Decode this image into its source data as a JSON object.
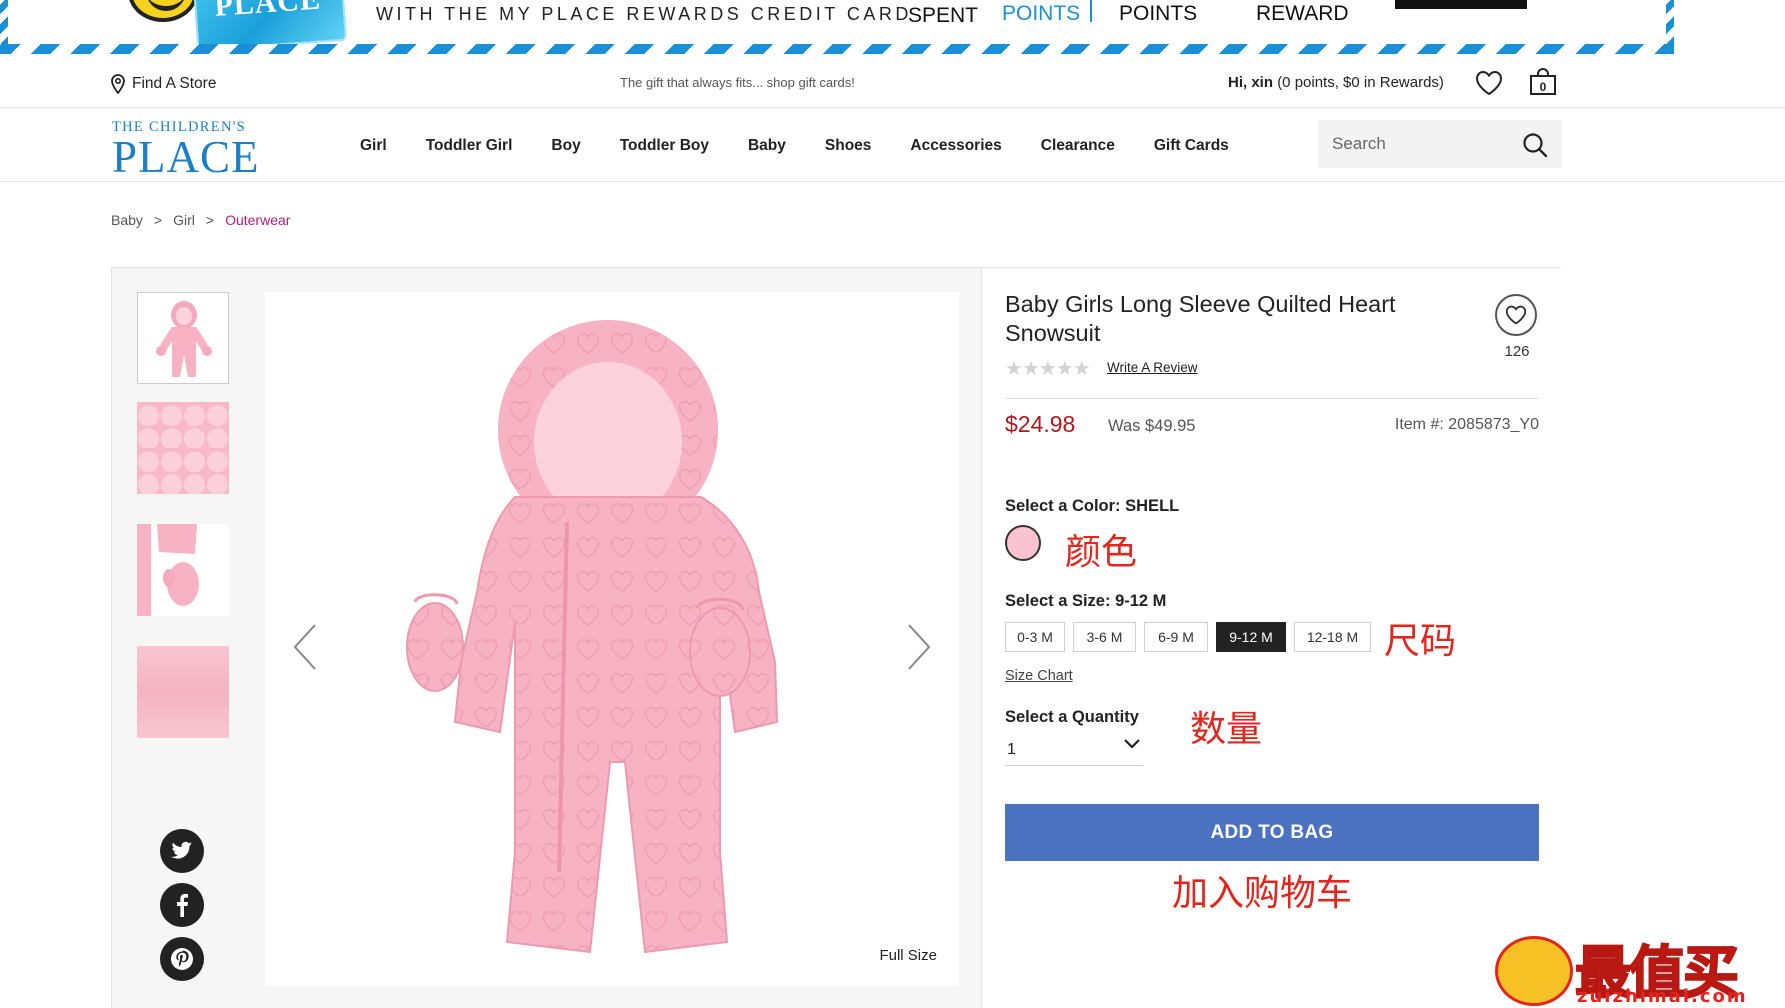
{
  "promo": {
    "card_text": "PLACE",
    "tagline": "WITH THE MY PLACE REWARDS CREDIT CARD",
    "spent": "SPENT",
    "points_blue": "POINTS",
    "points": "POINTS",
    "reward": "REWARD"
  },
  "util": {
    "find_store": "Find A Store",
    "message": "The gift that always fits... shop gift cards!",
    "greeting_name": "Hi, xin",
    "greeting_detail": "(0 points, $0 in Rewards)",
    "bag_count": "0"
  },
  "logo": {
    "line1": "THE CHILDREN'S",
    "line2": "PLACE"
  },
  "nav": [
    "Girl",
    "Toddler Girl",
    "Boy",
    "Toddler Boy",
    "Baby",
    "Shoes",
    "Accessories",
    "Clearance",
    "Gift Cards"
  ],
  "search": {
    "placeholder": "Search"
  },
  "breadcrumb": {
    "items": [
      "Baby",
      "Girl"
    ],
    "current": "Outerwear",
    "separator": ">"
  },
  "product": {
    "title": "Baby Girls Long Sleeve Quilted Heart Snowsuit",
    "favorites": "126",
    "rating": 0,
    "write_review": "Write A Review",
    "price": "$24.98",
    "was": "Was $49.95",
    "item_no": "Item #: 2085873_Y0",
    "color_label": "Select a Color:",
    "color_value": "SHELL",
    "color_swatch": "#f9c3cf",
    "size_label": "Select a Size:",
    "size_value": "9-12 M",
    "sizes": [
      "0-3 M",
      "3-6 M",
      "6-9 M",
      "9-12 M",
      "12-18 M"
    ],
    "selected_size_index": 3,
    "size_chart": "Size Chart",
    "qty_label": "Select a Quantity",
    "qty_value": "1",
    "add_to_bag": "ADD TO BAG",
    "full_size": "Full Size"
  },
  "annotations": {
    "color": "颜色",
    "size": "尺码",
    "quantity": "数量",
    "add_to_cart": "加入购物车"
  },
  "watermark": {
    "title": "最值买",
    "site": "zuizhimai.com"
  },
  "colors": {
    "brand_blue": "#1a7fc4",
    "sale_red": "#b0161d",
    "button_blue": "#4b72c0",
    "breadcrumb_current": "#b61f7b",
    "annotation_red": "#e0261d",
    "garment_pink": "#f7b3c4"
  }
}
